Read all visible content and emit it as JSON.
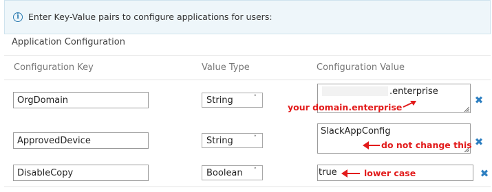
{
  "info": {
    "text": "Enter Key-Value pairs to configure applications for users:",
    "icon": "info-icon"
  },
  "section_title": "Application Configuration",
  "columns": {
    "key": "Configuration Key",
    "type": "Value Type",
    "value": "Configuration Value"
  },
  "rows": [
    {
      "key": "OrgDomain",
      "type": "String",
      "value": ".enterprise",
      "annotation": "your domain.enterprise"
    },
    {
      "key": "ApprovedDevice",
      "type": "String",
      "value": "SlackAppConfig",
      "annotation": "do not change this"
    },
    {
      "key": "DisableCopy",
      "type": "Boolean",
      "value": "true",
      "annotation": "lower case"
    }
  ],
  "colors": {
    "annotation": "#e21b1b",
    "remove_icon": "#2d7fc1",
    "banner_bg": "#eef6fa"
  }
}
